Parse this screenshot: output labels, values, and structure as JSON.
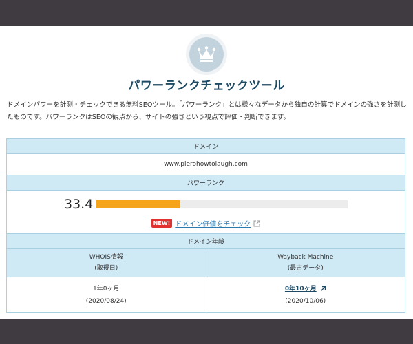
{
  "page": {
    "title": "パワーランクチェックツール",
    "description": "ドメインパワーを計測・チェックできる無料SEOツール。「パワーランク」とは様々なデータから独自の計算でドメインの強さを計測したものです。パワーランクはSEOの観点から、サイトの強さという視点で評価・判断できます。",
    "icon": "crown-icon"
  },
  "table": {
    "domain_header": "ドメイン",
    "domain_value": "www.pierohowtolaugh.com",
    "power_header": "パワーランク",
    "power_score": "33.4",
    "power_fill_percent": 33.4,
    "new_badge": "NEW!",
    "value_check_link": "ドメイン価値をチェック",
    "age_header": "ドメイン年齢",
    "whois": {
      "label": "WHOIS情報",
      "sublabel": "(取得日)",
      "age": "1年0ヶ月",
      "date": "(2020/08/24)"
    },
    "wayback": {
      "label": "Wayback Machine",
      "sublabel": "(最古データ)",
      "age": "0年10ヶ月",
      "date": "(2020/10/06)"
    }
  },
  "colors": {
    "background": "#403b40",
    "title": "#1e4a63",
    "header_cell": "#cfe9f5",
    "border": "#a9cfe2",
    "bar_fill": "#f5a41b",
    "bar_track": "#ececec",
    "new_badge": "#e03030",
    "link": "#2b7ab0"
  }
}
